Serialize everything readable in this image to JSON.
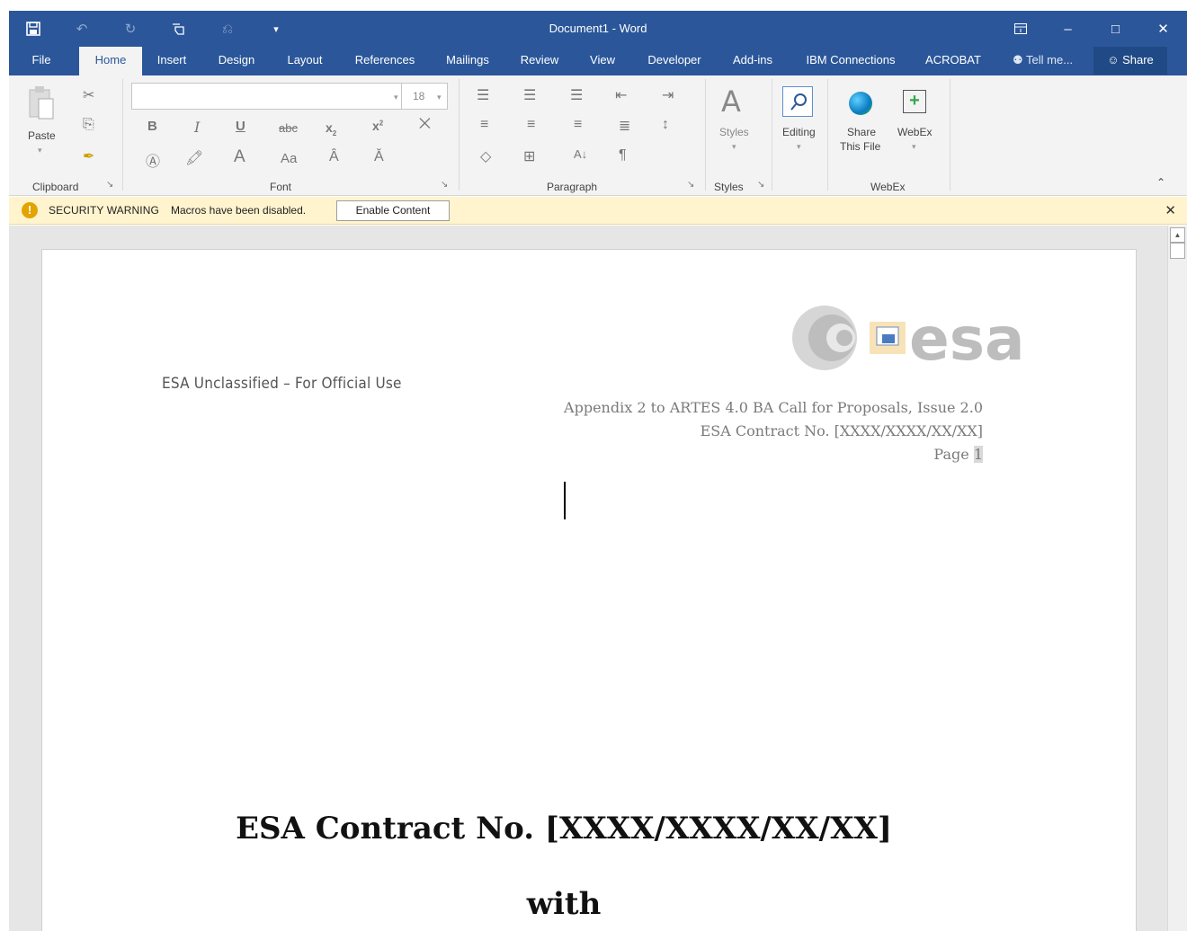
{
  "window": {
    "title": "Document1 - Word",
    "quick_access": [
      "save-icon",
      "undo-icon",
      "redo-icon",
      "touch-mode-icon",
      "customize-icon",
      "dropdown-icon"
    ],
    "controls": [
      "ribbon-display-icon",
      "minimize-icon",
      "maximize-icon",
      "close-icon"
    ]
  },
  "tabs": [
    {
      "label": "File"
    },
    {
      "label": "Home"
    },
    {
      "label": "Insert"
    },
    {
      "label": "Design"
    },
    {
      "label": "Layout"
    },
    {
      "label": "References"
    },
    {
      "label": "Mailings"
    },
    {
      "label": "Review"
    },
    {
      "label": "View"
    },
    {
      "label": "Developer"
    },
    {
      "label": "Add-ins"
    },
    {
      "label": "IBM Connections"
    },
    {
      "label": "ACROBAT"
    }
  ],
  "tell_me": "Tell me...",
  "share": "Share",
  "ribbon": {
    "clipboard": {
      "paste": "Paste",
      "label": "Clipboard"
    },
    "font": {
      "font_name": "",
      "font_size": "18",
      "label": "Font"
    },
    "paragraph": {
      "label": "Paragraph"
    },
    "styles": {
      "button": "Styles",
      "label": "Styles"
    },
    "editing": {
      "button": "Editing"
    },
    "webex": {
      "share_line1": "Share",
      "share_line2": "This File",
      "webex_button": "WebEx",
      "label": "WebEx"
    }
  },
  "security_bar": {
    "title": "SECURITY WARNING",
    "message": "Macros have been disabled.",
    "button": "Enable Content"
  },
  "document": {
    "classification": "ESA Unclassified – For Official Use",
    "header_line1": "Appendix 2 to ARTES 4.0 BA Call for Proposals, Issue 2.0",
    "header_line2": "ESA Contract No. [XXXX/XXXX/XX/XX]",
    "header_page_label": "Page",
    "header_page_number": "1",
    "logo_text": "esa",
    "heading1": "ESA Contract No. [XXXX/XXXX/XX/XX]",
    "heading2": "with"
  },
  "colors": {
    "word_blue": "#2b579a",
    "security_yellow": "#fff4ce"
  }
}
